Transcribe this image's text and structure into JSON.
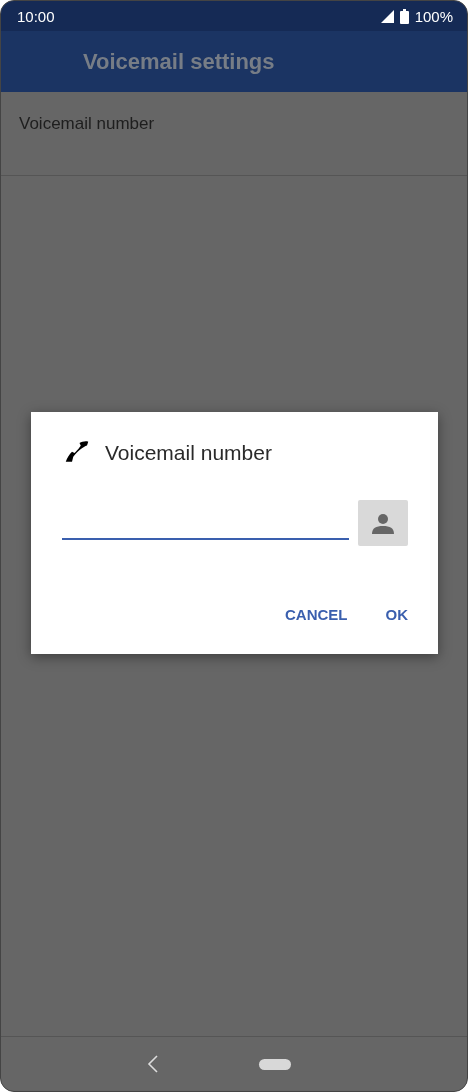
{
  "status_bar": {
    "time": "10:00",
    "battery": "100%"
  },
  "toolbar": {
    "title": "Voicemail settings"
  },
  "settings": [
    {
      "label": "Voicemail number"
    }
  ],
  "dialog": {
    "title": "Voicemail number",
    "buttons": [
      "CANCEL",
      "OK"
    ]
  }
}
